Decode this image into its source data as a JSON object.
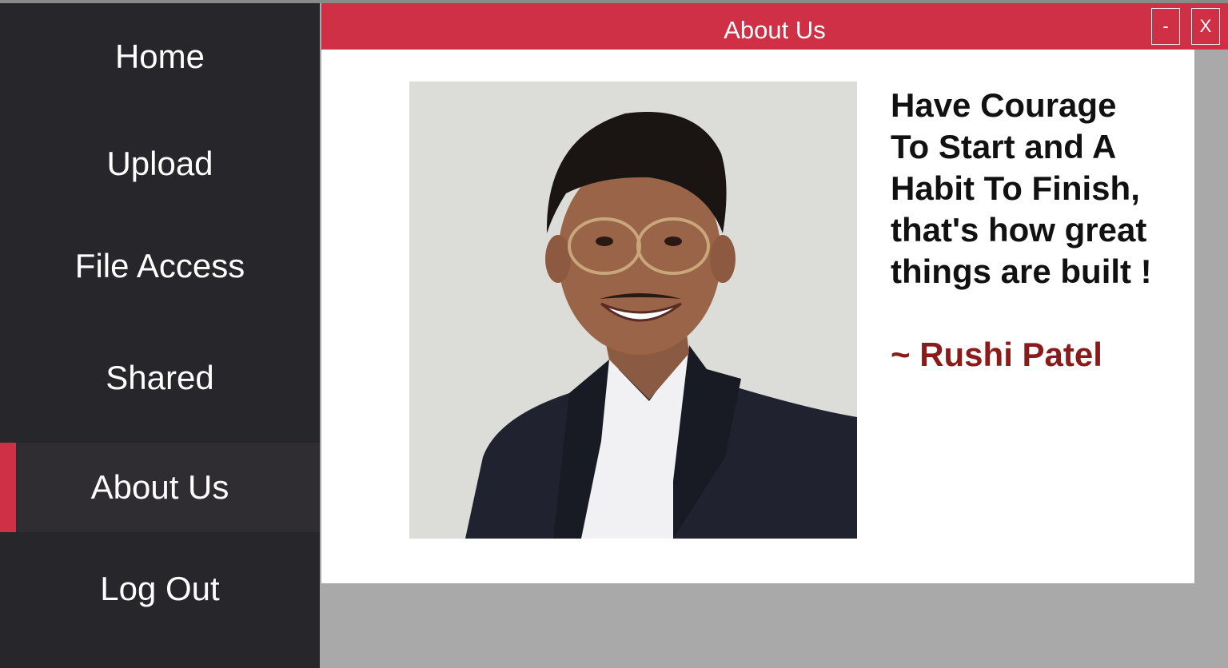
{
  "sidebar": {
    "items": [
      {
        "label": "Home"
      },
      {
        "label": "Upload"
      },
      {
        "label": "File Access"
      },
      {
        "label": "Shared"
      },
      {
        "label": "About Us",
        "active": true
      },
      {
        "label": "Log Out"
      }
    ]
  },
  "window": {
    "title": "About Us",
    "minimize_label": "-",
    "close_label": "X"
  },
  "about": {
    "quote_lines": [
      "Have Courage",
      "To Start and A",
      "Habit To Finish,",
      "that's how great",
      "things are built !"
    ],
    "author": "~ Rushi Patel",
    "photo": "profile-photo"
  },
  "colors": {
    "sidebar_bg": "#27262a",
    "active_item_bg": "#2f2d32",
    "accent": "#d03045",
    "author_text": "#8b1a1a",
    "desktop_bg": "#a9a9a9"
  }
}
